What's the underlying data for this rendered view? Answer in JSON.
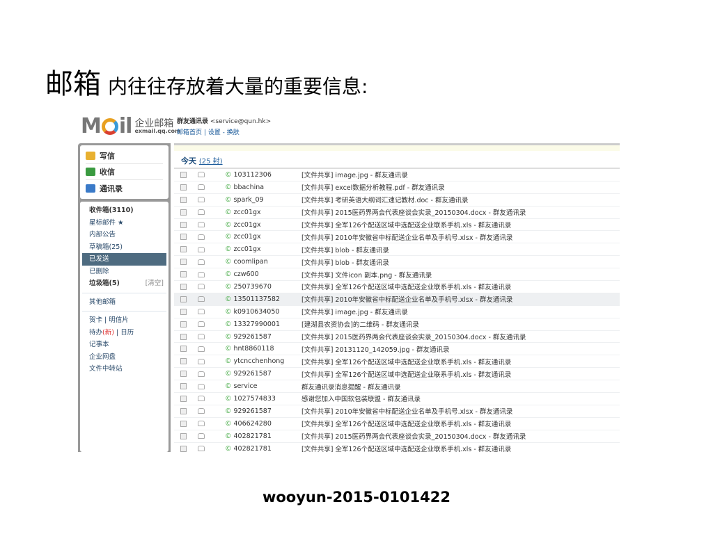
{
  "slide": {
    "title_big": "邮箱",
    "title_rest": "内往往存放着大量的重要信息:",
    "footer": "wooyun-2015-0101422"
  },
  "header": {
    "logo_text": "M  il",
    "logo_cn": "企业邮箱",
    "logo_domain": "exmail.qq.com",
    "account_name": "群友通讯录",
    "account_email": "<service@qun.hk>",
    "links": "邮箱首页 | 设置 - 换肤"
  },
  "quick": [
    {
      "label": "写信",
      "icon": "pencil-icon"
    },
    {
      "label": "收信",
      "icon": "inbox-download-icon"
    },
    {
      "label": "通讯录",
      "icon": "contacts-icon"
    }
  ],
  "folders": [
    {
      "label": "收件箱(3110)"
    },
    {
      "label": "星标邮件 ★"
    },
    {
      "label": "内部公告"
    },
    {
      "label": "草稿箱(25)"
    },
    {
      "label": "已发送",
      "selected": true
    },
    {
      "label": "已删除"
    },
    {
      "label": "垃圾箱(5)",
      "action": "[清空]"
    }
  ],
  "other": "其他邮箱",
  "tools": {
    "card": "贺卡",
    "postcard": "明信片",
    "todo": "待办",
    "todo_new": "(新)",
    "calendar": "日历",
    "notes": "记事本",
    "disk": "企业网盘",
    "transfer": "文件中转站"
  },
  "list": {
    "group": "今天",
    "count": "(25 封)",
    "rows": [
      [
        "103112306",
        "[文件共享] image.jpg - 群友通讯录"
      ],
      [
        "bbachina",
        "[文件共享] excel数据分析教程.pdf - 群友通讯录"
      ],
      [
        "spark_09",
        "[文件共享] 考研英语大纲词汇速记教材.doc - 群友通讯录"
      ],
      [
        "zcc01gx",
        "[文件共享] 2015医药界两会代表座谈会实录_20150304.docx - 群友通讯录"
      ],
      [
        "zcc01gx",
        "[文件共享] 全军126个配送区域中选配送企业联系手机.xls - 群友通讯录"
      ],
      [
        "zcc01gx",
        "[文件共享] 2010年安徽省中标配送企业名单及手机号.xlsx - 群友通讯录"
      ],
      [
        "zcc01gx",
        "[文件共享] blob - 群友通讯录"
      ],
      [
        "coomlipan",
        "[文件共享] blob - 群友通讯录"
      ],
      [
        "czw600",
        "[文件共享] 文件icon 副本.png - 群友通讯录"
      ],
      [
        "250739670",
        "[文件共享] 全军126个配送区域中选配送企业联系手机.xls - 群友通讯录"
      ],
      [
        "13501137582",
        "[文件共享] 2010年安徽省中标配送企业名单及手机号.xlsx - 群友通讯录"
      ],
      [
        "k0910634050",
        "[文件共享] image.jpg - 群友通讯录"
      ],
      [
        "13327990001",
        "[建湖县农资协会]的二维码 - 群友通讯录"
      ],
      [
        "929261587",
        "[文件共享] 2015医药界两会代表座谈会实录_20150304.docx - 群友通讯录"
      ],
      [
        "hnt8860118",
        "[文件共享] 20131120_142059.jpg - 群友通讯录"
      ],
      [
        "ytcncchenhong",
        "[文件共享] 全军126个配送区域中选配送企业联系手机.xls - 群友通讯录"
      ],
      [
        "929261587",
        "[文件共享] 全军126个配送区域中选配送企业联系手机.xls - 群友通讯录"
      ],
      [
        "service",
        "群友通讯录消息提醒 - 群友通讯录"
      ],
      [
        "1027574833",
        "感谢您加入中国软包装联盟 - 群友通讯录"
      ],
      [
        "929261587",
        "[文件共享] 2010年安徽省中标配送企业名单及手机号.xlsx - 群友通讯录"
      ],
      [
        "406624280",
        "[文件共享] 全军126个配送区域中选配送企业联系手机.xls - 群友通讯录"
      ],
      [
        "402821781",
        "[文件共享] 2015医药界两会代表座谈会实录_20150304.docx - 群友通讯录"
      ],
      [
        "402821781",
        "[文件共享] 全军126个配送区域中选配送企业联系手机.xls - 群友通讯录"
      ]
    ]
  }
}
